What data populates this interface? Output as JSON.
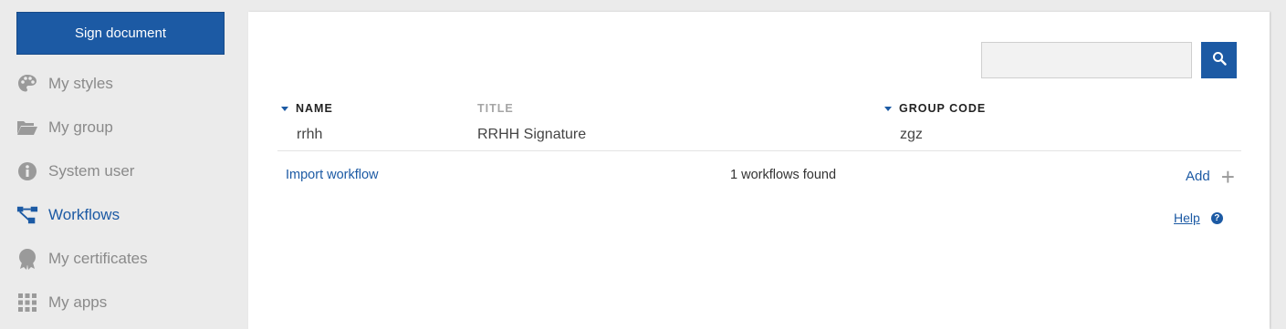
{
  "sidebar": {
    "sign_button": "Sign document",
    "items": [
      {
        "label": "My styles",
        "icon": "palette-icon",
        "active": false
      },
      {
        "label": "My group",
        "icon": "folder-open-icon",
        "active": false
      },
      {
        "label": "System user",
        "icon": "info-circle-icon",
        "active": false
      },
      {
        "label": "Workflows",
        "icon": "workflow-icon",
        "active": true
      },
      {
        "label": "My certificates",
        "icon": "certificate-icon",
        "active": false
      },
      {
        "label": "My apps",
        "icon": "apps-grid-icon",
        "active": false
      }
    ]
  },
  "search": {
    "value": "",
    "placeholder": ""
  },
  "table": {
    "columns": [
      "NAME",
      "TITLE",
      "GROUP CODE"
    ],
    "rows": [
      {
        "name": "rrhh",
        "title": "RRHH Signature",
        "group_code": "zgz"
      }
    ]
  },
  "footer": {
    "import_link": "Import workflow",
    "count_text": "1 workflows found",
    "add_label": "Add",
    "help_label": "Help"
  },
  "colors": {
    "accent": "#1c5aa4",
    "muted_text": "#8a8a8a",
    "background": "#ebebeb"
  }
}
